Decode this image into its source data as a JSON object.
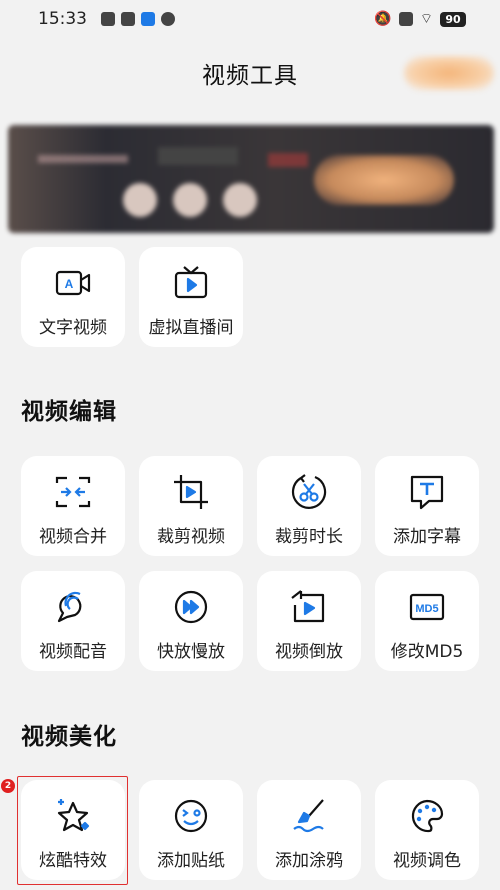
{
  "status_bar": {
    "time": "15:33",
    "battery": "90"
  },
  "header": {
    "title": "视频工具"
  },
  "top_tools": [
    {
      "label": "文字视频",
      "icon": "text-video-icon"
    },
    {
      "label": "虚拟直播间",
      "icon": "virtual-live-room-icon"
    }
  ],
  "video_edit": {
    "title": "视频编辑",
    "items": [
      {
        "label": "视频合并",
        "icon": "merge-icon"
      },
      {
        "label": "裁剪视频",
        "icon": "crop-icon"
      },
      {
        "label": "裁剪时长",
        "icon": "trim-duration-icon"
      },
      {
        "label": "添加字幕",
        "icon": "subtitle-icon"
      },
      {
        "label": "视频配音",
        "icon": "dubbing-icon"
      },
      {
        "label": "快放慢放",
        "icon": "speed-icon"
      },
      {
        "label": "视频倒放",
        "icon": "reverse-icon"
      },
      {
        "label": "修改MD5",
        "icon": "md5-icon"
      }
    ]
  },
  "video_beautify": {
    "title": "视频美化",
    "items": [
      {
        "label": "炫酷特效",
        "icon": "effects-icon"
      },
      {
        "label": "添加贴纸",
        "icon": "sticker-icon"
      },
      {
        "label": "添加涂鸦",
        "icon": "graffiti-icon"
      },
      {
        "label": "视频调色",
        "icon": "color-palette-icon"
      }
    ]
  },
  "highlight_badge": "2",
  "colors": {
    "accent": "#1e7ae6",
    "icon_stroke": "#111111",
    "highlight_border": "#e03030"
  }
}
